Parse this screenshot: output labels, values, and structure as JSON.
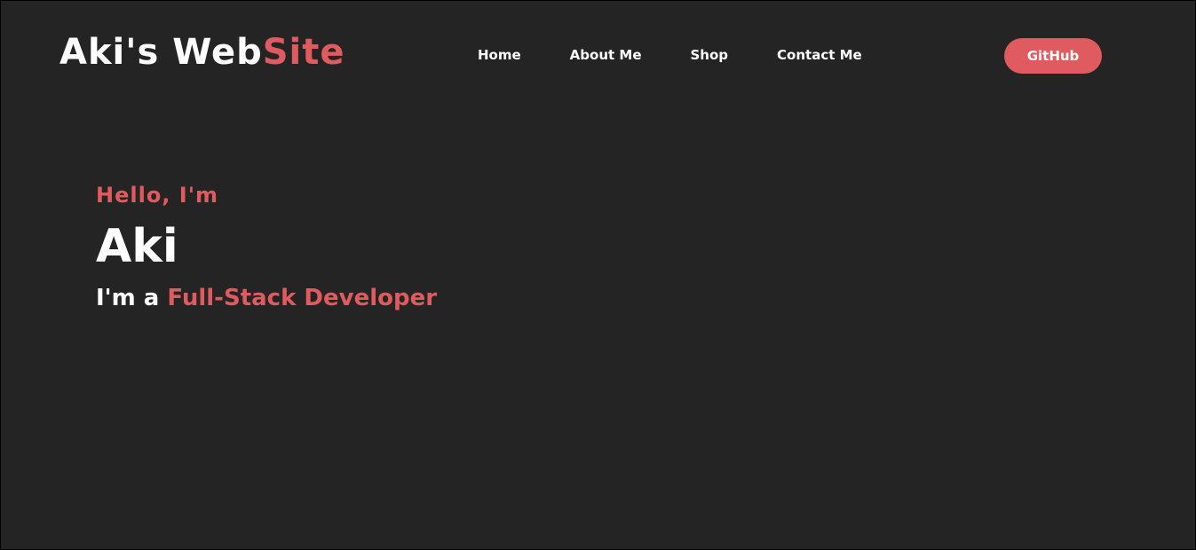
{
  "header": {
    "brand_main": "Aki's Web",
    "brand_accent": "Site",
    "nav": [
      {
        "label": "Home"
      },
      {
        "label": "About Me"
      },
      {
        "label": "Shop"
      },
      {
        "label": "Contact Me"
      }
    ],
    "github_label": "GitHub"
  },
  "hero": {
    "greeting": "Hello, I'm",
    "name": "Aki",
    "role_prefix": "I'm a ",
    "role_accent": "Full-Stack Developer"
  },
  "colors": {
    "background": "#242424",
    "accent": "#e05b5f",
    "text": "#ffffff"
  }
}
